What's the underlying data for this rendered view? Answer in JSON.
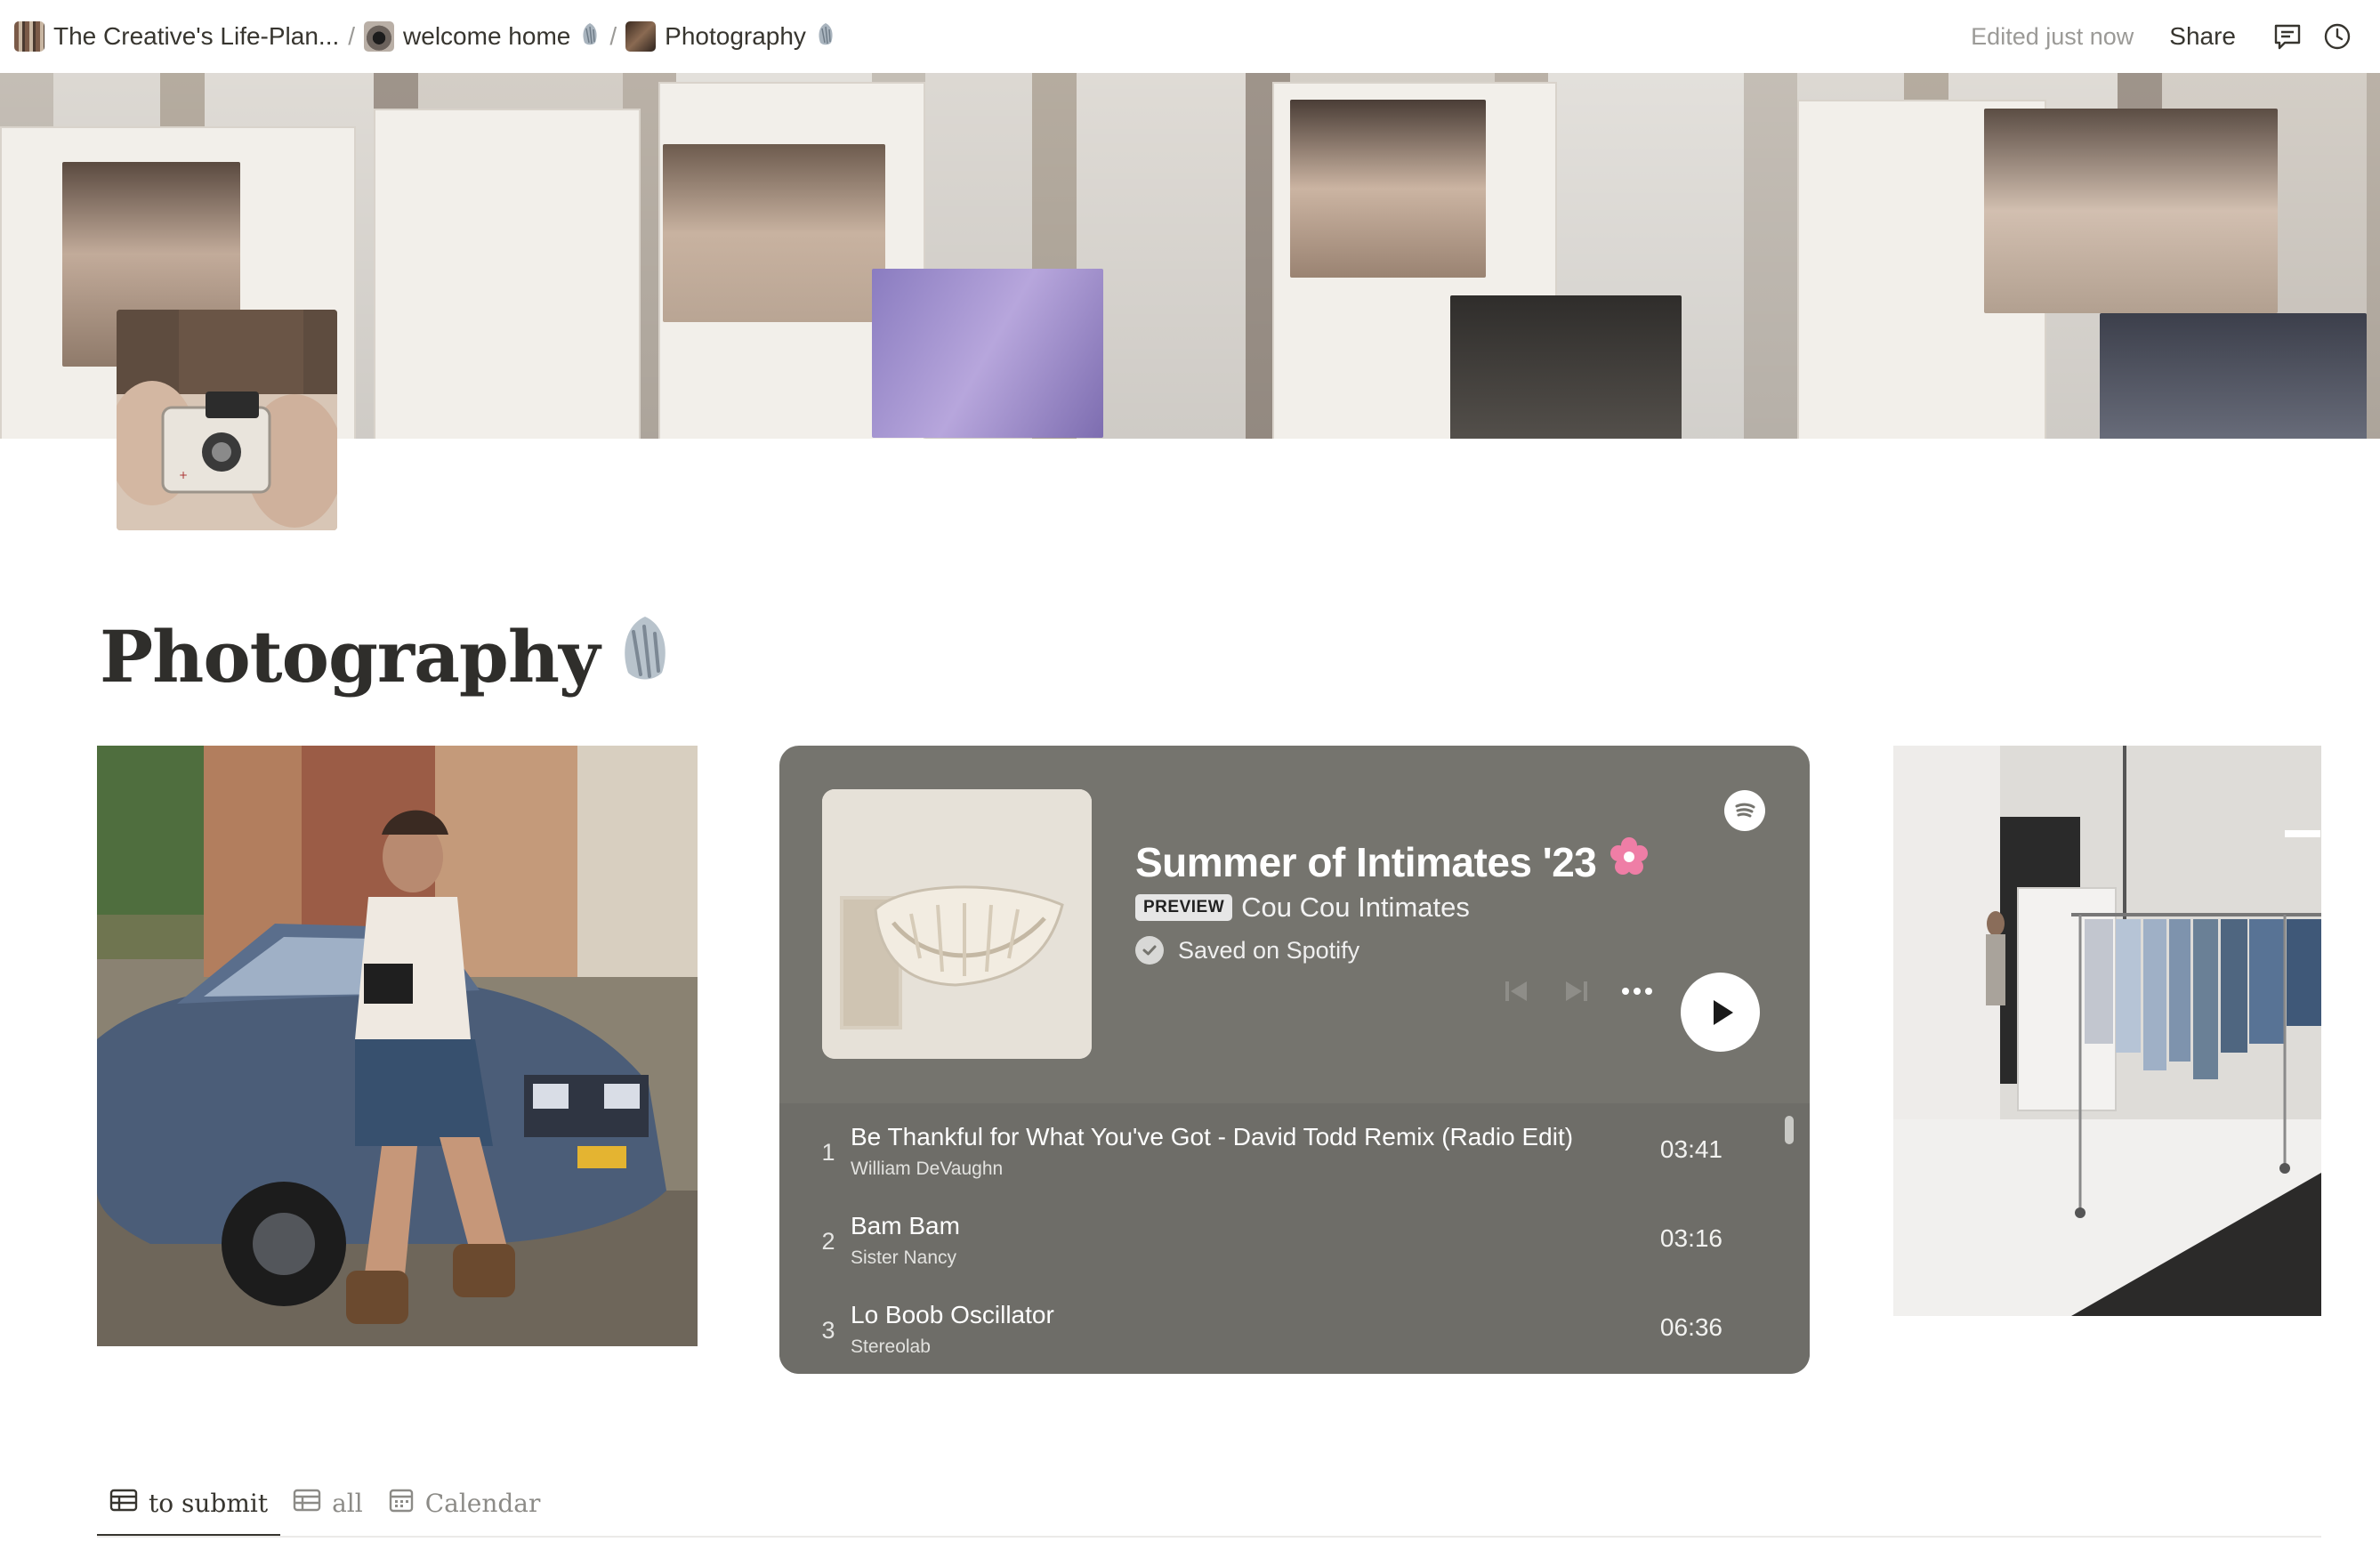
{
  "topbar": {
    "breadcrumbs": [
      {
        "label": "The Creative's Life-Plan...",
        "thumb": "mosaic-thumbnail",
        "emoji": ""
      },
      {
        "label": "welcome home",
        "thumb": "camera-thumbnail",
        "emoji": "shell"
      },
      {
        "label": "Photography",
        "thumb": "photo-thumbnail",
        "emoji": "shell"
      }
    ],
    "separator": "/",
    "edited_status": "Edited just now",
    "share_label": "Share",
    "icons": [
      "comment-icon",
      "clock-icon"
    ]
  },
  "page": {
    "title": "Photography",
    "title_emoji": "shell"
  },
  "spotify": {
    "playlist_title": "Summer of Intimates '23",
    "title_emoji": "flower",
    "preview_badge": "PREVIEW",
    "artist": "Cou Cou Intimates",
    "saved_text": "Saved on Spotify",
    "tracks": [
      {
        "num": "1",
        "name": "Be Thankful for What You've Got - David Todd Remix (Radio Edit)",
        "artist": "William DeVaughn",
        "duration": "03:41"
      },
      {
        "num": "2",
        "name": "Bam Bam",
        "artist": "Sister Nancy",
        "duration": "03:16"
      },
      {
        "num": "3",
        "name": "Lo Boob Oscillator",
        "artist": "Stereolab",
        "duration": "06:36"
      }
    ]
  },
  "db_tabs": [
    {
      "label": "to submit",
      "icon": "table-icon",
      "active": true
    },
    {
      "label": "all",
      "icon": "table-icon",
      "active": false
    },
    {
      "label": "Calendar",
      "icon": "calendar-icon",
      "active": false
    }
  ],
  "colors": {
    "spotify_bg": "#75746e",
    "tracklist_bg": "#6e6d68",
    "text_primary": "#37352f",
    "text_muted": "#9b9a97"
  }
}
